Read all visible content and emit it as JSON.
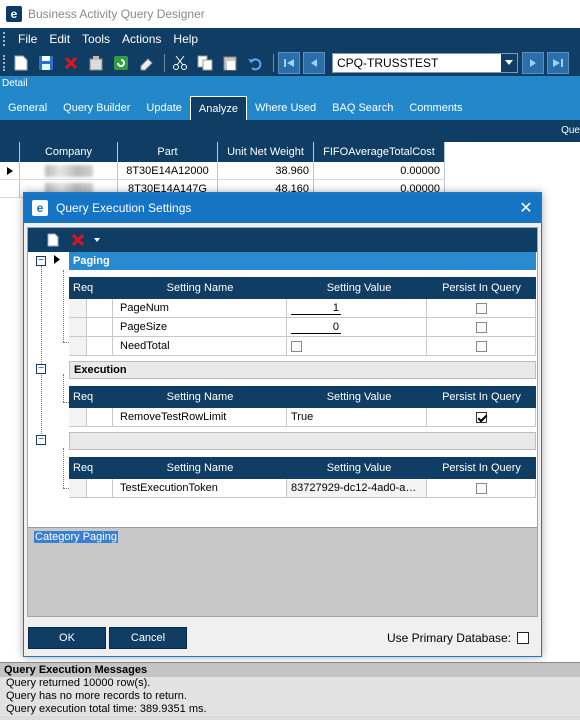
{
  "window": {
    "title": "Business Activity Query Designer",
    "logo_letter": "e"
  },
  "menu": {
    "items": [
      "File",
      "Edit",
      "Tools",
      "Actions",
      "Help"
    ]
  },
  "toolbar": {
    "query_combo_value": "CPQ-TRUSSTEST"
  },
  "detail_label": "Detail",
  "tabs": [
    "General",
    "Query Builder",
    "Update",
    "Analyze",
    "Where Used",
    "BAQ Search",
    "Comments"
  ],
  "active_tab": "Analyze",
  "query_bar_label": "Que",
  "results_grid": {
    "columns": [
      "Company",
      "Part",
      "Unit Net Weight",
      "FIFOAverageTotalCost"
    ],
    "rows": [
      {
        "part": "8T30E14A12000",
        "weight": "38.960",
        "cost": "0.00000"
      },
      {
        "part": "8T30E14A147G",
        "weight": "48.160",
        "cost": "0.00000"
      }
    ]
  },
  "dialog": {
    "title": "Query Execution Settings",
    "close_glyph": "✕",
    "grid_columns": {
      "req": "Req",
      "name": "Setting Name",
      "value": "Setting Value",
      "persist": "Persist In Query"
    },
    "categories": [
      {
        "name": "Paging",
        "rows": [
          {
            "name": "PageNum",
            "value": "1",
            "type": "underlined",
            "persist": false
          },
          {
            "name": "PageSize",
            "value": "0",
            "type": "underlined",
            "persist": false
          },
          {
            "name": "NeedTotal",
            "value": "",
            "type": "checkbox",
            "persist": false
          }
        ]
      },
      {
        "name": "Execution",
        "rows": [
          {
            "name": "RemoveTestRowLimit",
            "value": "True",
            "type": "text",
            "persist": true
          }
        ]
      },
      {
        "name": "",
        "rows": [
          {
            "name": "TestExecutionToken",
            "value": "83727929-dc12-4ad0-a…",
            "type": "text",
            "persist": false
          }
        ]
      }
    ],
    "description": "Category Paging",
    "ok_label": "OK",
    "cancel_label": "Cancel",
    "primary_db_label": "Use Primary Database:"
  },
  "messages": {
    "title": "Query Execution Messages",
    "lines": [
      "Query returned 10000 row(s).",
      "Query has no more records to return.",
      "Query execution total time: 389.9351 ms."
    ]
  },
  "colors": {
    "navy": "#0f3d63",
    "accent_blue": "#2388c9",
    "dialog_blue": "#1574c4"
  }
}
